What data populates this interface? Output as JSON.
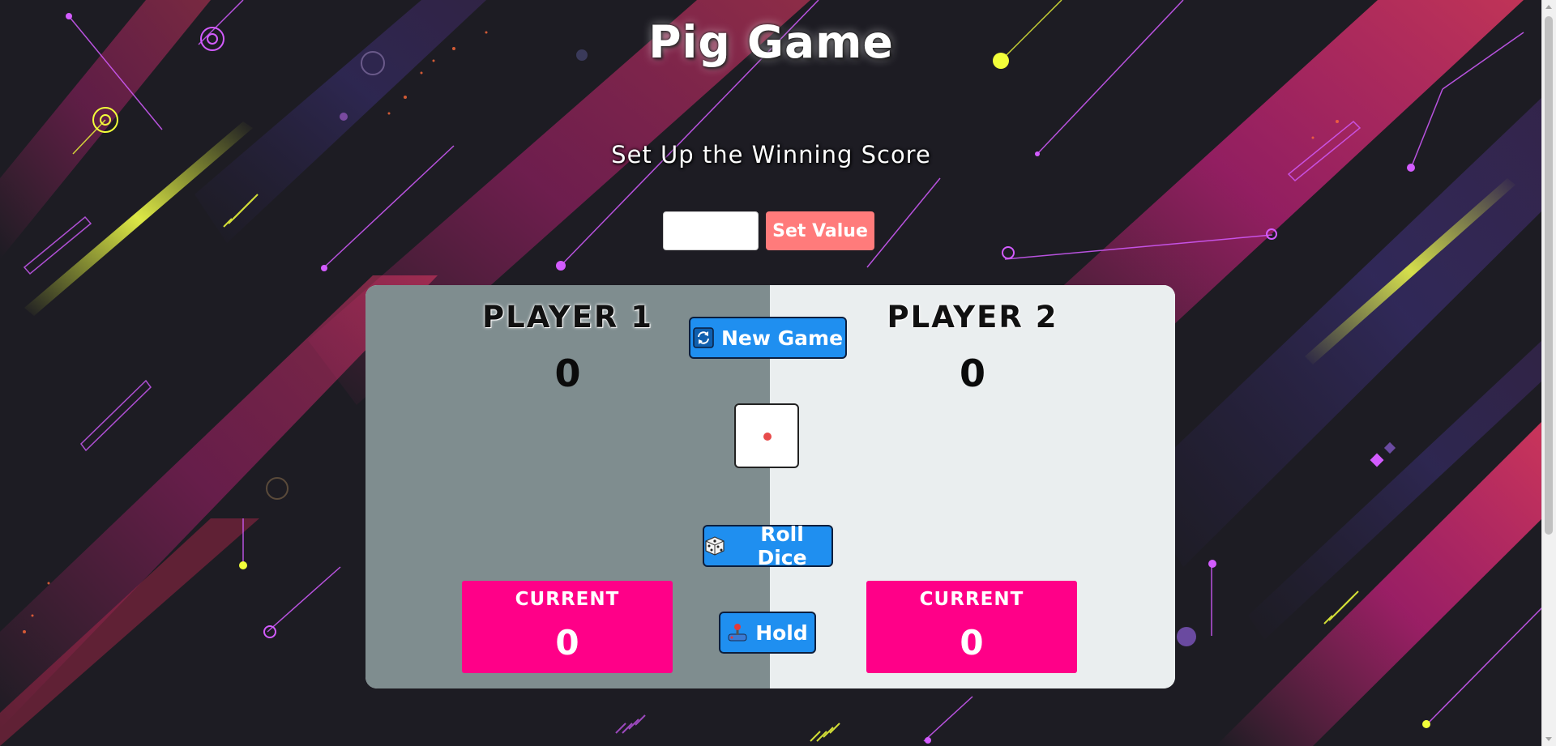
{
  "page": {
    "title": "Pig Game",
    "subtitle": "Set Up the Winning Score"
  },
  "setup": {
    "input_value": "",
    "input_placeholder": "",
    "set_button_label": "Set Value"
  },
  "players": [
    {
      "name": "PLAYER 1",
      "score": "0",
      "current_label": "CURRENT",
      "current_score": "0",
      "active": true
    },
    {
      "name": "PLAYER 2",
      "score": "0",
      "current_label": "CURRENT",
      "current_score": "0",
      "active": false
    }
  ],
  "controls": {
    "new_game_label": "New Game",
    "new_game_icon": "refresh-icon",
    "roll_dice_label": "Roll Dice",
    "roll_dice_icon": "dice-icon",
    "hold_label": "Hold",
    "hold_icon": "joystick-icon"
  },
  "dice": {
    "value": 1,
    "pip_color": "#e84b4b"
  },
  "colors": {
    "active_panel": "#7f8d8f",
    "inactive_panel": "#eaeeef",
    "current_box": "#ff0088",
    "button": "#1f8ff0",
    "set_button": "#ff7b7b",
    "background": "#1c1b22"
  }
}
